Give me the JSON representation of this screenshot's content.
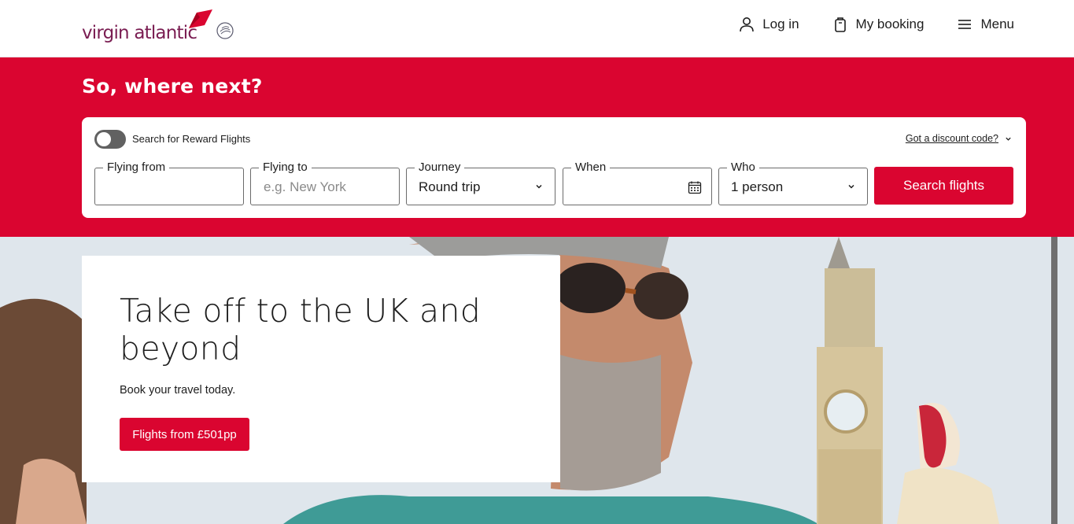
{
  "header": {
    "logo_text": "virgin atlantic",
    "logo_flag_text": "Virgin",
    "nav": {
      "login_label": "Log in",
      "booking_label": "My booking",
      "menu_label": "Menu"
    }
  },
  "search": {
    "heading": "So, where next?",
    "reward_toggle_label": "Search for Reward Flights",
    "reward_toggle_on": false,
    "discount_link": "Got a discount code?",
    "fields": {
      "from": {
        "label": "Flying from",
        "value": ""
      },
      "to": {
        "label": "Flying to",
        "placeholder": "e.g. New York"
      },
      "journey": {
        "label": "Journey",
        "value": "Round trip"
      },
      "when": {
        "label": "When",
        "value": ""
      },
      "who": {
        "label": "Who",
        "value": "1 person"
      }
    },
    "submit_label": "Search flights"
  },
  "hero": {
    "title": "Take off to the UK and beyond",
    "subtitle": "Book your travel today.",
    "cta_label": "Flights from £501pp"
  },
  "colors": {
    "brand_red": "#da0530",
    "logo_purple": "#7a1d52"
  },
  "icons": {
    "login": "user-icon",
    "booking": "bag-icon",
    "menu": "hamburger-icon",
    "calendar": "calendar-icon",
    "chevron": "chevron-down-icon"
  }
}
